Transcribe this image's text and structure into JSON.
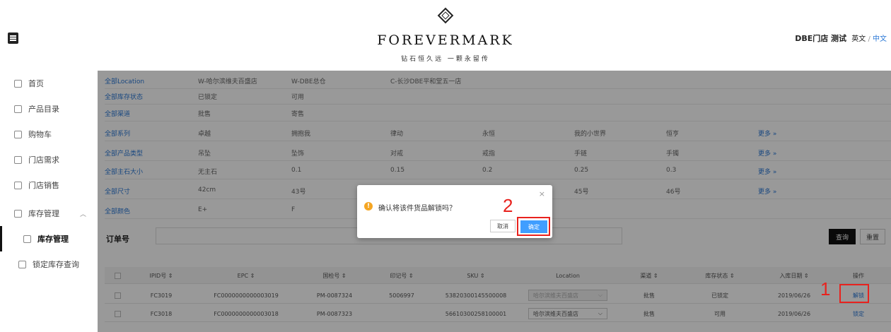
{
  "header": {
    "brand": "FOREVERMARK",
    "tagline": "钻石恒久远 一颗永留传",
    "store_name": "DBE门店 测试",
    "lang_en": "英文",
    "lang_sep": "/",
    "lang_zh": "中文"
  },
  "sidebar": {
    "items": [
      {
        "label": "首页",
        "icon": "home-icon"
      },
      {
        "label": "产品目录",
        "icon": "grid-icon"
      },
      {
        "label": "购物车",
        "icon": "cart-icon"
      },
      {
        "label": "门店需求",
        "icon": "grid-icon"
      },
      {
        "label": "门店销售",
        "icon": "sales-icon"
      },
      {
        "label": "库存管理",
        "icon": "inventory-icon"
      },
      {
        "label": "库存管理",
        "icon": "inventory-icon"
      },
      {
        "label": "锁定库存查询",
        "icon": "lock-search-icon"
      }
    ]
  },
  "filters": [
    {
      "label": "全部Location",
      "options": [
        "W-哈尔滨维夫百盛店",
        "W-DBE总仓",
        "C-长沙DBE平和堂五一店"
      ],
      "more": ""
    },
    {
      "label": "全部库存状态",
      "options": [
        "已锁定",
        "可用"
      ],
      "more": ""
    },
    {
      "label": "全部渠道",
      "options": [
        "批售",
        "寄售"
      ],
      "more": ""
    },
    {
      "label": "全部系列",
      "options": [
        "卓越",
        "拥抱我",
        "律动",
        "永恒",
        "我的小世界",
        "恒亨"
      ],
      "more": "更多 »"
    },
    {
      "label": "全部产品类型",
      "options": [
        "吊坠",
        "坠饰",
        "对戒",
        "戒指",
        "手链",
        "手镯"
      ],
      "more": "更多 »"
    },
    {
      "label": "全部主石大小",
      "options": [
        "无主石",
        "0.1",
        "0.15",
        "0.2",
        "0.25",
        "0.3"
      ],
      "more": "更多 »"
    },
    {
      "label": "全部尺寸",
      "options": [
        "42cm",
        "43号",
        "",
        "",
        "45号",
        "46号"
      ],
      "more": "更多 »"
    },
    {
      "label": "全部颜色",
      "options": [
        "E+",
        "F"
      ],
      "more": ""
    }
  ],
  "search": {
    "order_label": "订单号",
    "order_value": "",
    "query": "查询",
    "reset": "重置"
  },
  "table": {
    "columns": [
      "",
      "IPID号 ⇕",
      "EPC ⇕",
      "国检号 ⇕",
      "印记号 ⇕",
      "SKU ⇕",
      "Location",
      "渠道 ⇕",
      "库存状态 ⇕",
      "入库日期 ⇕",
      "操作"
    ],
    "rows": [
      {
        "ipid": "FC3019",
        "epc": "FC0000000000003019",
        "gj": "PM-0087324",
        "yj": "5006997",
        "sku": "53820300145500008",
        "location": "哈尔滨维夫百盛店",
        "channel": "批售",
        "status": "已锁定",
        "date": "2019/06/26",
        "op": "解锁",
        "loc_disabled": true
      },
      {
        "ipid": "FC3018",
        "epc": "FC0000000000003018",
        "gj": "PM-0087323",
        "yj": "",
        "sku": "56610300258100001",
        "location": "哈尔滨维夫百盛店",
        "channel": "批售",
        "status": "可用",
        "date": "2019/06/26",
        "op": "锁定",
        "loc_disabled": false
      }
    ]
  },
  "dialog": {
    "close": "×",
    "message": "确认将该件货品解锁吗？",
    "cancel": "取消",
    "confirm": "确定"
  },
  "annotations": {
    "num_1": "1",
    "num_2": "2",
    "color": "#e8221e"
  },
  "colors": {
    "link": "#2b78d6",
    "primary_button": "#409eff",
    "warning": "#f5a623"
  }
}
